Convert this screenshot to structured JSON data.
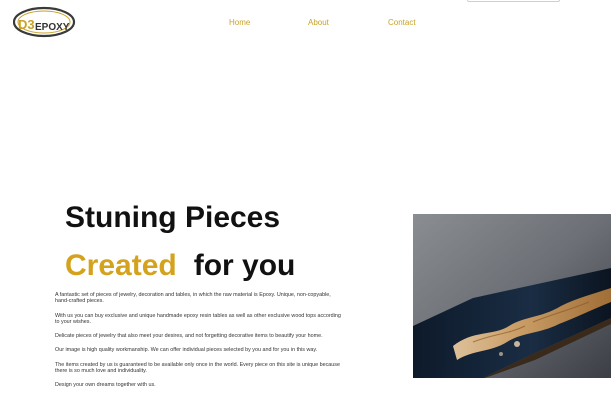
{
  "logo": {
    "text": "EPOXY",
    "mark": "D3",
    "colors": {
      "gold": "#c9a227",
      "dark": "#333333"
    }
  },
  "nav": {
    "home": "Home",
    "about": "About",
    "contact": "Contact",
    "color": "#c9a227"
  },
  "hero": {
    "line1": "Stuning Pieces",
    "line2_accent": "Created",
    "line2_rest": "for you",
    "accent_color": "#d4a21d"
  },
  "paragraphs": [
    "A fantastic set of pieces of jewelry, decoration and tables, in which the raw material is Epoxy. Unique, non-copyable, hand-crafted pieces.",
    "With us you can buy exclusive and unique handmade epoxy resin tables as well as other exclusive wood tops according to your wishes.",
    "Delicate pieces of jewelry that also meet your desires, and not forgetting decorative items to beautify your home.",
    "Our image is high quality workmanship. We can offer individual pieces selected by you and for you in this way.",
    "The items created by us is guaranteed to be available only once in the world. Every piece on this site is unique because there is so much love and individuality.",
    "Design your own dreams together with us."
  ],
  "photo": {
    "icon": "epoxy-wood-table-photo"
  }
}
